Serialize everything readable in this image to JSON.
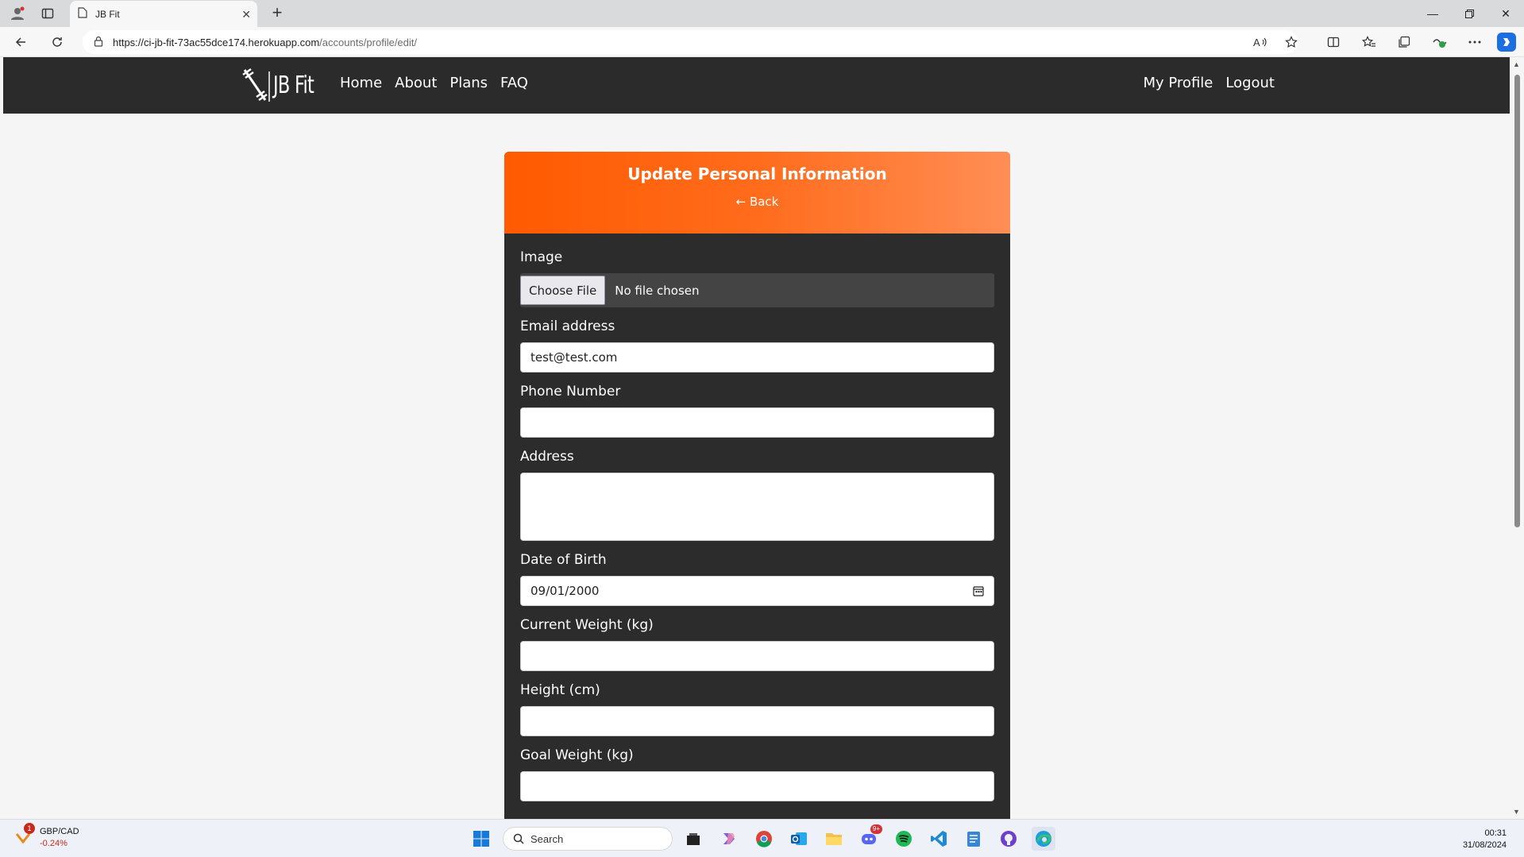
{
  "browser": {
    "tab_title": "JB Fit",
    "url_host": "https://ci-jb-fit-73ac55dce174.herokuapp.com",
    "url_path": "/accounts/profile/edit/"
  },
  "navbar": {
    "logo_text": "JB Fit",
    "links": [
      "Home",
      "About",
      "Plans",
      "FAQ"
    ],
    "right_links": [
      "My Profile",
      "Logout"
    ]
  },
  "card": {
    "title": "Update Personal Information",
    "back_label": "← Back"
  },
  "form": {
    "image_label": "Image",
    "file_button": "Choose File",
    "file_status": "No file chosen",
    "email_label": "Email address",
    "email_value": "test@test.com",
    "phone_label": "Phone Number",
    "phone_value": "",
    "address_label": "Address",
    "address_value": "",
    "dob_label": "Date of Birth",
    "dob_value": "09/01/2000",
    "weight_label": "Current Weight (kg)",
    "weight_value": "",
    "height_label": "Height (cm)",
    "height_value": "",
    "goal_label": "Goal Weight (kg)"
  },
  "taskbar": {
    "widget_name": "GBP/CAD",
    "widget_change": "-0.24%",
    "widget_badge": "1",
    "search_placeholder": "Search",
    "time": "00:31",
    "date": "31/08/2024",
    "discord_badge": "9+"
  },
  "colors": {
    "accent_orange": "#ff5a00",
    "navbar_bg": "#2b2b2b",
    "card_bg": "#2c2c2c"
  }
}
